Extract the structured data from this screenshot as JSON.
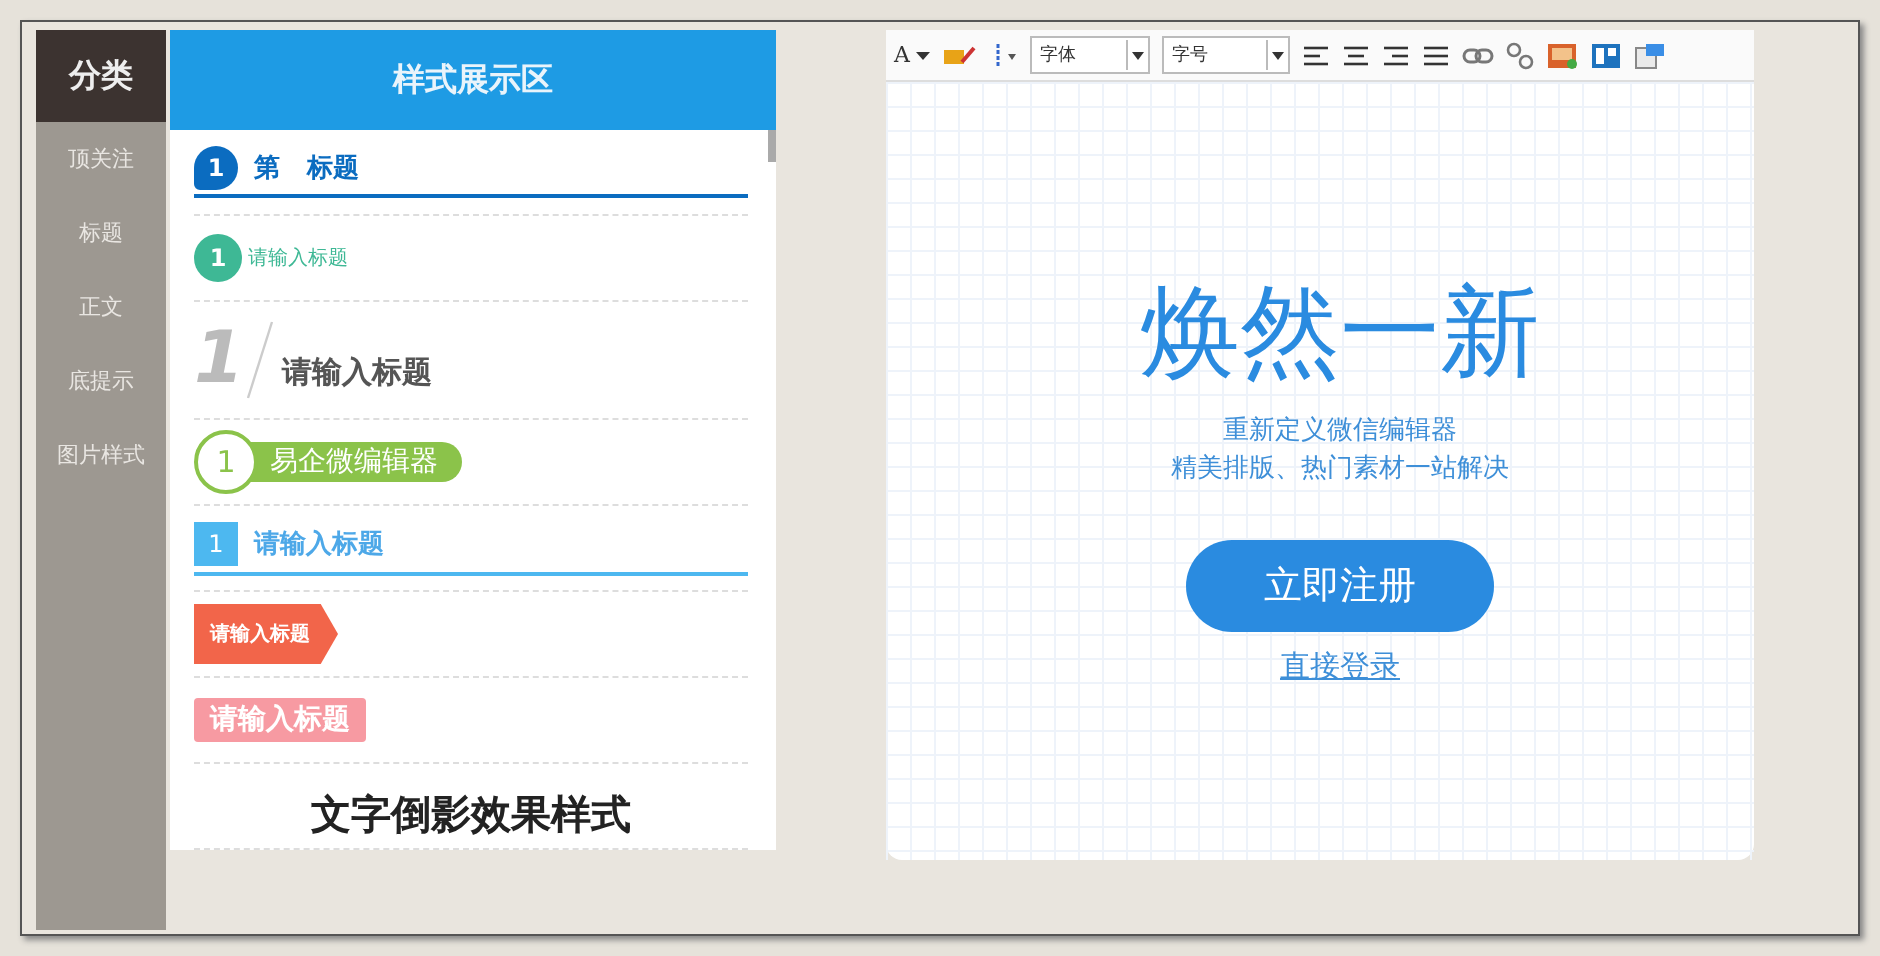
{
  "sidebar": {
    "title": "分类",
    "items": [
      {
        "label": "顶关注",
        "selected": false
      },
      {
        "label": "标题",
        "selected": false
      },
      {
        "label": "正文",
        "selected": false
      },
      {
        "label": "底提示",
        "selected": false
      },
      {
        "label": "图片样式",
        "selected": false
      }
    ]
  },
  "styles_panel": {
    "title": "样式展示区",
    "samples": [
      {
        "kind": "blue-underline",
        "number": "1",
        "text": "第   标题"
      },
      {
        "kind": "green-circle",
        "number": "1",
        "text": "请输入标题"
      },
      {
        "kind": "slash-number",
        "number": "1",
        "text": "请输入标题"
      },
      {
        "kind": "pill",
        "number": "1",
        "text": "易企微编辑器"
      },
      {
        "kind": "square-number",
        "number": "1",
        "text": "请输入标题"
      },
      {
        "kind": "arrow-tag",
        "text": "请输入标题"
      },
      {
        "kind": "pink-tag",
        "text": "请输入标题"
      },
      {
        "kind": "big-text",
        "text": "文字倒影效果样式"
      }
    ]
  },
  "editor": {
    "toolbar": {
      "font_color_label": "A",
      "font_placeholder": "字体",
      "size_placeholder": "字号"
    },
    "headline": "焕然一新",
    "subtitle_lines": [
      "重新定义微信编辑器",
      "精美排版、热门素材一站解决"
    ],
    "register_button": "立即注册",
    "login_link": "直接登录"
  }
}
